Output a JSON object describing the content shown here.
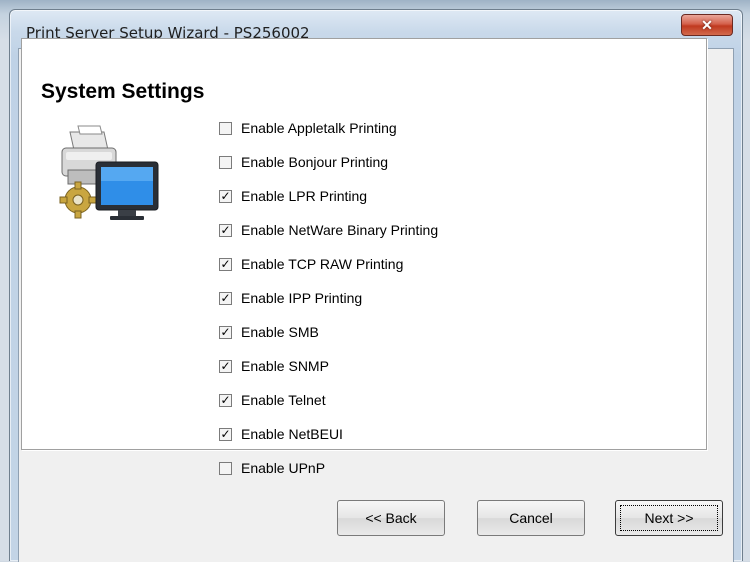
{
  "window": {
    "title": "Print Server Setup Wizard - PS256002",
    "close_glyph": "✕"
  },
  "section": {
    "title": "System Settings",
    "icon": "printer-computer-gear-icon"
  },
  "options": [
    {
      "label": "Enable Appletalk Printing",
      "checked": false
    },
    {
      "label": "Enable Bonjour Printing",
      "checked": false
    },
    {
      "label": "Enable LPR Printing",
      "checked": true
    },
    {
      "label": "Enable NetWare Binary Printing",
      "checked": true
    },
    {
      "label": "Enable TCP RAW Printing",
      "checked": true
    },
    {
      "label": "Enable IPP Printing",
      "checked": true
    },
    {
      "label": "Enable SMB",
      "checked": true
    },
    {
      "label": "Enable SNMP",
      "checked": true
    },
    {
      "label": "Enable Telnet",
      "checked": true
    },
    {
      "label": "Enable NetBEUI",
      "checked": true
    },
    {
      "label": "Enable UPnP",
      "checked": false
    }
  ],
  "buttons": {
    "back": "<< Back",
    "cancel": "Cancel",
    "next": "Next >>"
  },
  "colors": {
    "close_button": "#c0391f",
    "window_frame": "#bfd2e6",
    "dialog_face": "#f0f0f0"
  }
}
